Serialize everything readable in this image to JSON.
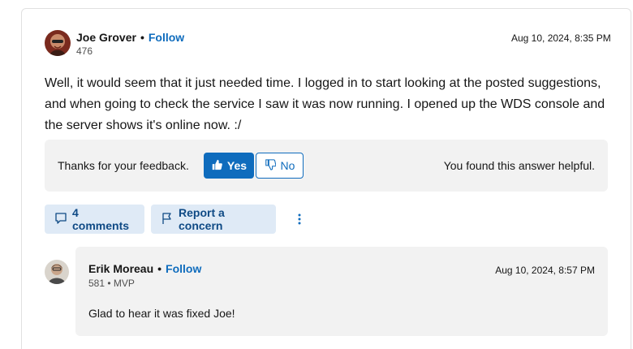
{
  "answer": {
    "author": {
      "name": "Joe Grover",
      "follow_label": "Follow",
      "reputation": "476",
      "avatar_icon": "user-avatar-icon"
    },
    "date": "Aug 10, 2024, 8:35 PM",
    "text": "Well, it would seem that it just needed time. I logged in to start looking at the posted suggestions, and when going to check the service I saw it was now running. I opened up the WDS console and the server shows it's online now. :/"
  },
  "feedback": {
    "prompt": "Thanks for your feedback.",
    "yes_label": "Yes",
    "no_label": "No",
    "status": "You found this answer helpful."
  },
  "actions": {
    "comments_label": "4 comments",
    "report_label": "Report a concern",
    "more_icon": "more-vertical-icon"
  },
  "comment": {
    "author": {
      "name": "Erik Moreau",
      "follow_label": "Follow",
      "reputation": "581 • MVP"
    },
    "date": "Aug 10, 2024, 8:57 PM",
    "text": "Glad to hear it was fixed Joe!"
  },
  "colors": {
    "accent": "#0f6cbd",
    "panel_bg": "#f2f2f2",
    "action_bg": "#dfeaf6"
  }
}
